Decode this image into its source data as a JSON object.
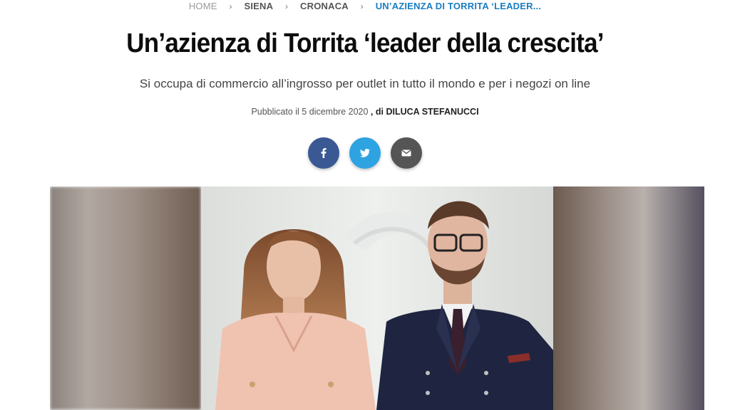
{
  "breadcrumb": {
    "home": "HOME",
    "city": "SIENA",
    "section": "CRONACA",
    "current": "UN’AZIENZA DI TORRITA ‘LEADER...",
    "separator": "›"
  },
  "article": {
    "title": "Un’azienza di Torrita ‘leader della crescita’",
    "subtitle": "Si occupa di commercio all’ingrosso per outlet in tutto il mondo e per i negozi on line",
    "published": "Pubblicato il 5 dicembre 2020",
    "author_prefix": ", di",
    "author": "DILUCA STEFANUCCI"
  },
  "share": {
    "facebook_icon": "facebook-icon",
    "twitter_icon": "twitter-icon",
    "email_icon": "email-icon"
  },
  "colors": {
    "breadcrumb_current": "#1a7ec2",
    "facebook": "#3a5893",
    "twitter": "#2ea3e2",
    "email": "#555555"
  }
}
